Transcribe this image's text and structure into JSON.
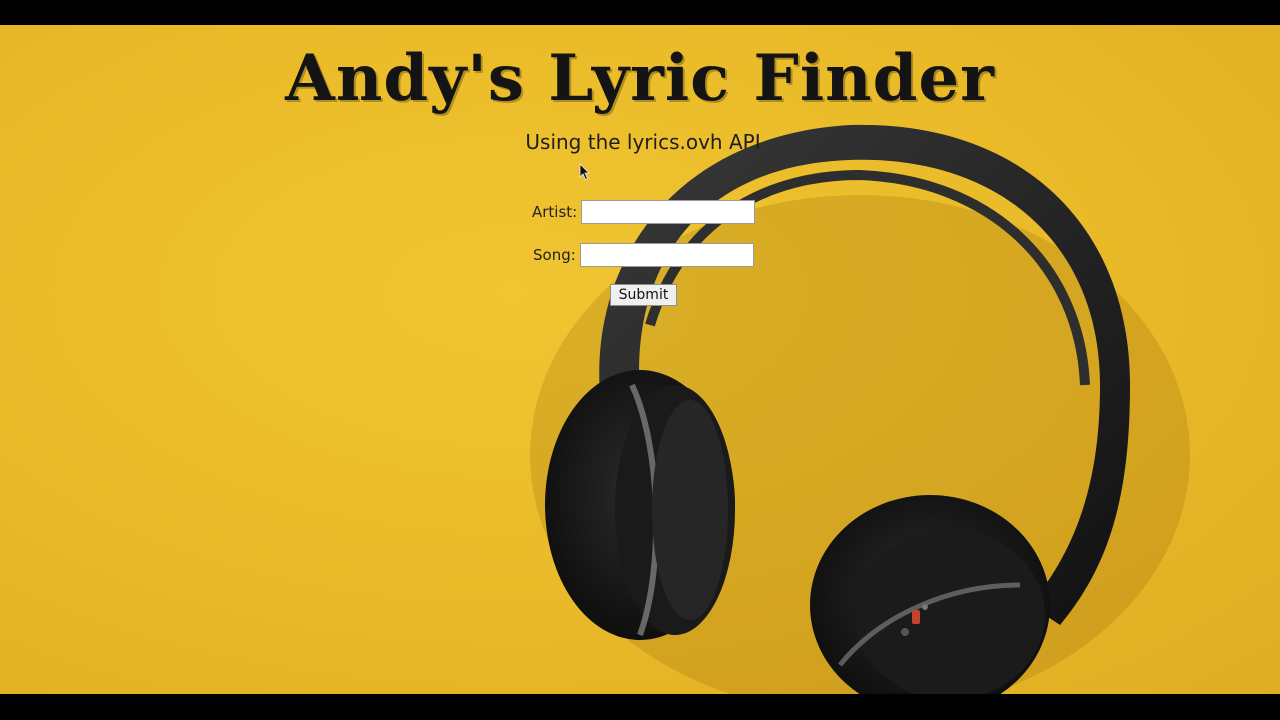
{
  "page": {
    "title": "Andy's Lyric Finder",
    "subtitle": "Using the lyrics.ovh API"
  },
  "form": {
    "artist_label": "Artist:",
    "artist_value": "",
    "song_label": "Song:",
    "song_value": "",
    "submit_label": "Submit"
  },
  "background": {
    "image": "headphones-photo",
    "color": "#ebbc2a"
  }
}
